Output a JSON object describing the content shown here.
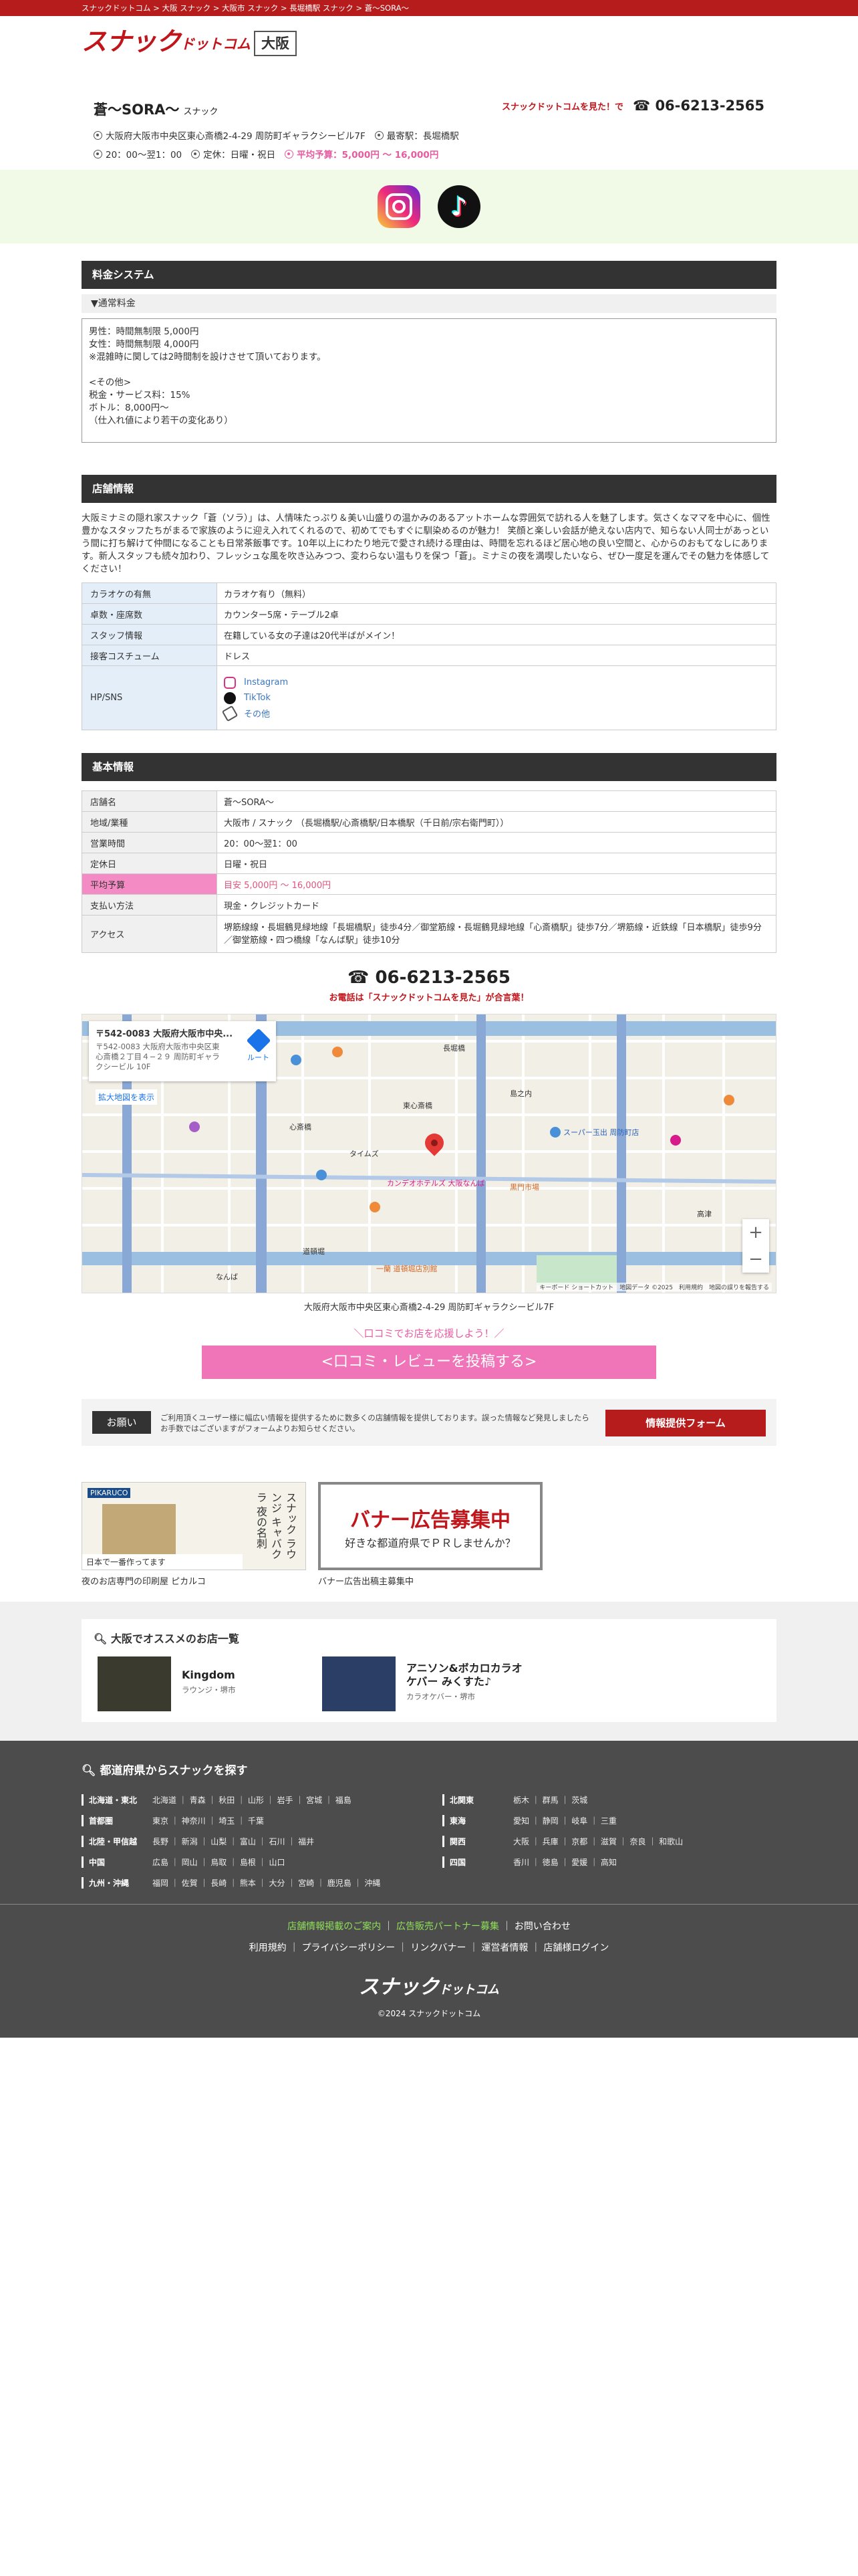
{
  "breadcrumb": "スナックドットコム > 大阪 スナック > 大阪市 スナック > 長堀橋駅 スナック > 蒼〜SORA〜",
  "logo": {
    "main": "スナック",
    "sub": "ドットコム"
  },
  "region": "大阪",
  "shop": {
    "name": "蒼〜SORA〜",
    "category": "スナック",
    "tel_note": "スナックドットコムを見た！で",
    "tel": "06-6213-2565",
    "address": "大阪府大阪市中央区東心斎橋2-4-29 周防町ギャラクシービル7F",
    "station": "最寄駅：長堀橋駅",
    "hours": "20：00〜翌1：00",
    "holiday": "定休：日曜・祝日",
    "budget": "平均予算：5,000円 〜 16,000円"
  },
  "pricing": {
    "title": "料金システム",
    "sub": "▼通常料金",
    "lines": [
      "男性：時間無制限 5,000円",
      "女性：時間無制限 4,000円",
      "※混雑時に関しては2時間制を設けさせて頂いております。",
      "",
      "<その他>",
      "税金・サービス料：15%",
      "ボトル：8,000円〜",
      "（仕入れ値により若干の変化あり）"
    ]
  },
  "store": {
    "title": "店舗情報",
    "description": "大阪ミナミの隠れ家スナック「蒼（ソラ）」は、人情味たっぷり＆美い山盛りの温かみのあるアットホームな雰囲気で訪れる人を魅了します。気さくなママを中心に、個性豊かなスタッフたちがまるで家族のように迎え入れてくれるので、初めてでもすぐに馴染めるのが魅力！ 笑顔と楽しい会話が絶えない店内で、知らない人同士があっという間に打ち解けて仲間になることも日常茶飯事です。10年以上にわたり地元で愛され続ける理由は、時間を忘れるほど居心地の良い空間と、心からのおもてなしにあります。新人スタッフも続々加わり、フレッシュな風を吹き込みつつ、変わらない温もりを保つ「蒼」。ミナミの夜を満喫したいなら、ぜひ一度足を運んでその魅力を体感してください！",
    "rows": [
      {
        "label": "カラオケの有無",
        "value": "カラオケ有り（無料）"
      },
      {
        "label": "卓数・座席数",
        "value": "カウンター5席・テーブル2卓"
      },
      {
        "label": "スタッフ情報",
        "value": "在籍している女の子達は20代半ばがメイン！"
      },
      {
        "label": "接客コスチューム",
        "value": "ドレス"
      }
    ],
    "sns_label": "HP/SNS",
    "sns": [
      "Instagram",
      "TikTok",
      "その他"
    ]
  },
  "basic": {
    "title": "基本情報",
    "rows": [
      {
        "label": "店舗名",
        "value": "蒼〜SORA〜"
      },
      {
        "label": "地域/業種",
        "value": "大阪市 / スナック （長堀橋駅/心斎橋駅/日本橋駅（千日前/宗右衛門町））"
      },
      {
        "label": "営業時間",
        "value": "20：00〜翌1：00"
      },
      {
        "label": "定休日",
        "value": "日曜・祝日"
      },
      {
        "label": "平均予算",
        "value": "目安 5,000円 〜 16,000円"
      },
      {
        "label": "支払い方法",
        "value": "現金・クレジットカード"
      },
      {
        "label": "アクセス",
        "value": "堺筋線線・長堀鶴見緑地線「長堀橋駅」徒歩4分／御堂筋線・長堀鶴見緑地線「心斎橋駅」徒歩7分／堺筋線・近鉄線「日本橋駅」徒歩9分／御堂筋線・四つ橋線「なんば駅」徒歩10分"
      }
    ]
  },
  "telblock": {
    "tel": "06-6213-2565",
    "note": "お電話は「スナックドットコムを見た」が合言葉！"
  },
  "map": {
    "card_title": "〒542-0083 大阪府大阪市中央...",
    "card_addr": "〒542-0083 大阪府大阪市中央区東心斎橋２丁目４−２９ 周防町ギャラクシービル 10F",
    "route": "ルート",
    "big_link": "拡大地図を表示",
    "footer": "キーボード ショートカット　地図データ ©2025　利用規約　地図の誤りを報告する",
    "labels": {
      "nagahori": "長堀橋",
      "shinsaibashi": "心斎橋",
      "higashi": "東心斎橋",
      "shimanouchi": "島之内",
      "supermarket": "スーパー玉出 周防町店",
      "hotel": "カンデオホテルズ 大阪なんば",
      "parking": "タイムズ",
      "dotonbori": "道頓堀",
      "kuromon": "黒門市場",
      "namba": "なんば",
      "ichigo": "一蘭 道頓堀店別館",
      "kouzu": "高津"
    }
  },
  "map_address": "大阪府大阪市中央区東心斎橋2-4-29 周防町ギャラクシービル7F",
  "review": {
    "note": "＼口コミでお店を応援しよう！／",
    "button": "<口コミ・レビューを投稿する>"
  },
  "request": {
    "label": "お願い",
    "text": "ご利用頂くユーザー様に幅広い情報を提供するために数多くの店舗情報を提供しております。誤った情報など発見しましたらお手数ではございますがフォームよりお知らせください。",
    "button": "情報提供フォーム"
  },
  "banners": [
    {
      "caption": "夜のお店専門の印刷屋 ピカルコ",
      "brand": "PIKARUCO",
      "vert": "スナック ラウンジ キャバクラ 夜の名刺",
      "tag": "日本で一番作ってます"
    },
    {
      "caption": "バナー広告出稿主募集中",
      "title": "バナー広告募集中",
      "sub": "好きな都道府県でＰＲしませんか？"
    }
  ],
  "recommend": {
    "title": "大阪でオススメのお店一覧",
    "items": [
      {
        "name": "Kingdom",
        "sub": "ラウンジ・堺市"
      },
      {
        "name": "アニソン&ボカロカラオケバー みくすた♪",
        "sub": "カラオケバー・堺市"
      }
    ]
  },
  "footer": {
    "title": "都道府県からスナックを探す",
    "left": [
      {
        "region": "北海道・東北",
        "prefs": "北海道 ｜ 青森 ｜ 秋田 ｜ 山形 ｜ 岩手 ｜ 宮城 ｜ 福島"
      },
      {
        "region": "首都圏",
        "prefs": "東京 ｜ 神奈川 ｜ 埼玉 ｜ 千葉"
      },
      {
        "region": "北陸・甲信越",
        "prefs": "長野 ｜ 新潟 ｜ 山梨 ｜ 富山 ｜ 石川 ｜ 福井"
      },
      {
        "region": "中国",
        "prefs": "広島 ｜ 岡山 ｜ 鳥取 ｜ 島根 ｜ 山口"
      },
      {
        "region": "九州・沖縄",
        "prefs": "福岡 ｜ 佐賀 ｜ 長崎 ｜ 熊本 ｜ 大分 ｜ 宮崎 ｜ 鹿児島 ｜ 沖縄"
      }
    ],
    "right": [
      {
        "region": "北関東",
        "prefs": "栃木 ｜ 群馬 ｜ 茨城"
      },
      {
        "region": "東海",
        "prefs": "愛知 ｜ 静岡 ｜ 岐阜 ｜ 三重"
      },
      {
        "region": "関西",
        "prefs": "大阪 ｜ 兵庫 ｜ 京都 ｜ 滋賀 ｜ 奈良 ｜ 和歌山"
      },
      {
        "region": "四国",
        "prefs": "香川 ｜ 徳島 ｜ 愛媛 ｜ 高知"
      }
    ],
    "links1": [
      "店舗情報掲載のご案内",
      "広告販売パートナー募集",
      "お問い合わせ"
    ],
    "links2": [
      "利用規約",
      "プライバシーポリシー",
      "リンクバナー",
      "運営者情報",
      "店舗様ログイン"
    ],
    "logo_main": "スナック",
    "logo_sub": "ドットコム",
    "copyright": "©2024 スナックドットコム"
  },
  "colors": {
    "brand_red": "#c0151b",
    "accent_pink": "#e85ba0",
    "link_blue": "#3a76c2"
  }
}
